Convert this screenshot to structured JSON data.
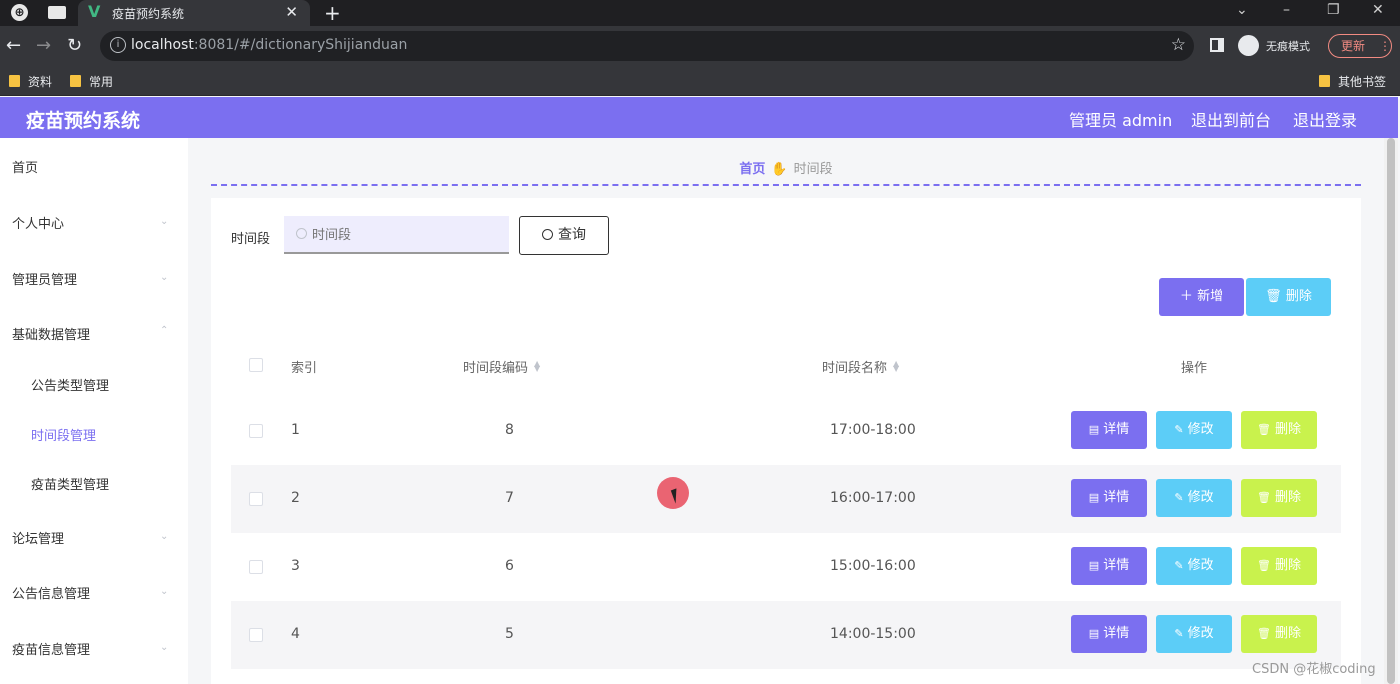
{
  "browser": {
    "tab_title": "疫苗预约系统",
    "url_host": "localhost",
    "url_rest": ":8081/#/dictionaryShijianduan",
    "incognito_label": "无痕模式",
    "update_label": "更新",
    "bookmarks": [
      "资料",
      "常用"
    ],
    "other_bookmarks": "其他书签"
  },
  "header": {
    "brand": "疫苗预约系统",
    "user": "管理员 admin",
    "front": "退出到前台",
    "logout": "退出登录"
  },
  "sidebar": {
    "items": [
      {
        "label": "首页"
      },
      {
        "label": "个人中心"
      },
      {
        "label": "管理员管理"
      },
      {
        "label": "基础数据管理"
      },
      {
        "label": "公告类型管理"
      },
      {
        "label": "时间段管理"
      },
      {
        "label": "疫苗类型管理"
      },
      {
        "label": "论坛管理"
      },
      {
        "label": "公告信息管理"
      },
      {
        "label": "疫苗信息管理"
      }
    ]
  },
  "breadcrumb": {
    "home": "首页",
    "current": "时间段"
  },
  "search": {
    "label": "时间段",
    "placeholder": "时间段",
    "button": "查询"
  },
  "toolbar": {
    "add": "新增",
    "delete": "删除"
  },
  "table": {
    "columns": [
      "索引",
      "时间段编码",
      "时间段名称",
      "操作"
    ],
    "rows": [
      {
        "index": "1",
        "code": "8",
        "name": "17:00-18:00"
      },
      {
        "index": "2",
        "code": "7",
        "name": "16:00-17:00"
      },
      {
        "index": "3",
        "code": "6",
        "name": "15:00-16:00"
      },
      {
        "index": "4",
        "code": "5",
        "name": "14:00-15:00"
      }
    ],
    "actions": {
      "detail": "详情",
      "edit": "修改",
      "remove": "删除"
    }
  },
  "watermark": "CSDN @花椒coding",
  "colors": {
    "accent": "#7b6ff0",
    "info": "#5ccdf7",
    "warning": "#c9f24d"
  }
}
